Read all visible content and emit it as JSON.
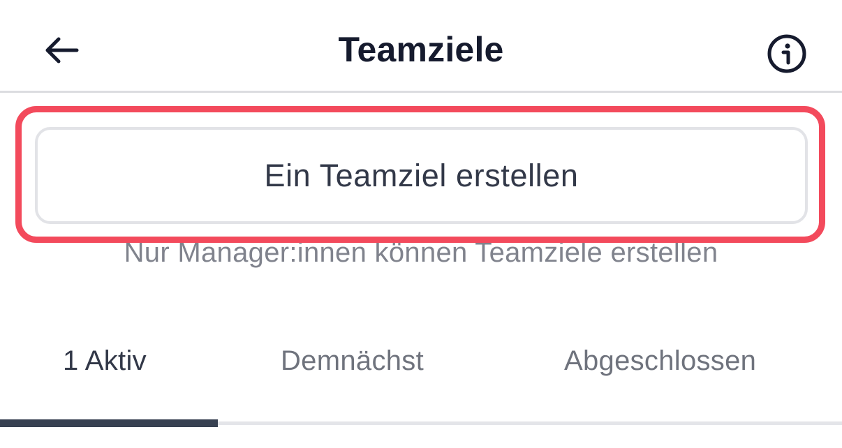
{
  "header": {
    "title": "Teamziele",
    "back_icon": "arrow-left-icon",
    "info_icon": "info-circle-icon"
  },
  "create": {
    "button_label": "Ein Teamziel erstellen",
    "hint": "Nur Manager:innen können Teamziele erstellen"
  },
  "tabs": [
    {
      "label": "1 Aktiv",
      "selected": true
    },
    {
      "label": "Demnächst",
      "selected": false
    },
    {
      "label": "Abgeschlossen",
      "selected": false
    }
  ],
  "colors": {
    "highlight": "#f34a5c",
    "text_dark": "#161b2e",
    "tab_indicator": "#384152"
  }
}
